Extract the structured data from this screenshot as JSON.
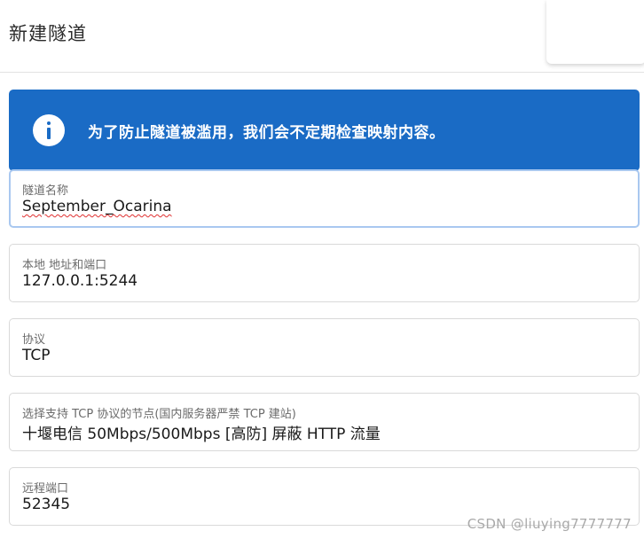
{
  "header": {
    "title": "新建隧道"
  },
  "alert": {
    "icon": "info-icon",
    "color": "#1a6bc5",
    "text": "为了防止隧道被滥用，我们会不定期检查映射内容。"
  },
  "fields": [
    {
      "label": "隧道名称",
      "value": "September_Ocarina"
    },
    {
      "label": "本地 地址和端口",
      "value": "127.0.0.1:5244"
    },
    {
      "label": "协议",
      "value": "TCP"
    },
    {
      "label": "选择支持 TCP 协议的节点(国内服务器严禁 TCP 建站)",
      "value": "十堰电信 50Mbps/500Mbps [高防] 屏蔽 HTTP 流量"
    },
    {
      "label": "远程端口",
      "value": "52345"
    }
  ],
  "watermark": "CSDN @liuying7777777"
}
